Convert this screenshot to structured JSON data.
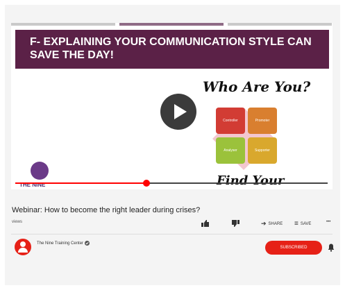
{
  "video": {
    "slide_title": "F- EXPLAINING YOUR COMMUNICATION STYLE CAN SAVE THE DAY!",
    "slide_question": "Who Are You?",
    "slide_footer": "Find Your",
    "logo_text": "THE NINE",
    "quadrants": [
      "Controller",
      "Promoter",
      "Analyser",
      "Supporter"
    ],
    "progress": 0.42
  },
  "info": {
    "title": "Webinar: How to become the right leader during crises?",
    "views_label": "views",
    "share_label": "SHARE",
    "save_label": "SAVE",
    "more_label": "•••"
  },
  "channel": {
    "name": "The Nine Training Center",
    "verified_icon": "verified-badge-icon",
    "subscribe_label": "SUBSCRIBED",
    "bell_icon": "bell-icon"
  },
  "colors": {
    "accent_red": "#e62117",
    "slide_banner": "#5b2147"
  }
}
